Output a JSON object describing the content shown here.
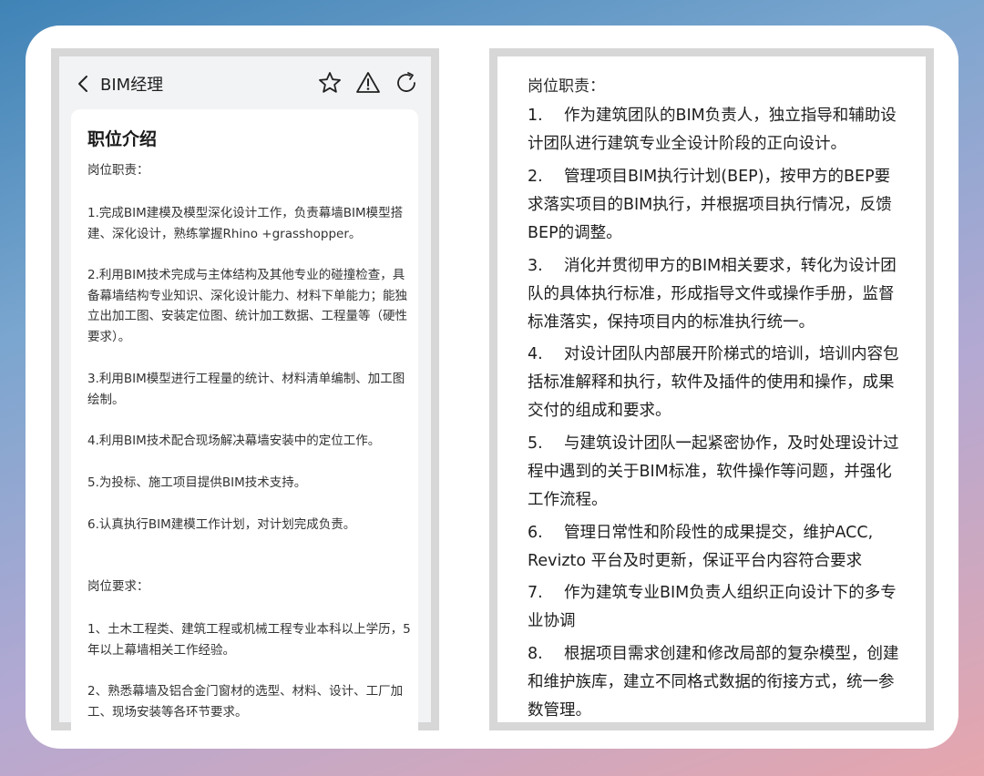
{
  "navbar": {
    "title": "BIM经理",
    "icons": [
      "back-chevron-icon",
      "star-icon",
      "warning-icon",
      "share-icon"
    ]
  },
  "job_card": {
    "section_title": "职位介绍",
    "duties_label": "岗位职责：",
    "duties": [
      "1.完成BIM建模及模型深化设计工作，负责幕墙BIM模型搭建、深化设计，熟练掌握Rhino +grasshopper。",
      "2.利用BIM技术完成与主体结构及其他专业的碰撞检查，具备幕墙结构专业知识、深化设计能力、材料下单能力；能独立出加工图、安装定位图、统计加工数据、工程量等（硬性要求）。",
      "3.利用BIM模型进行工程量的统计、材料清单编制、加工图绘制。",
      "4.利用BIM技术配合现场解决幕墙安装中的定位工作。",
      "5.为投标、施工项目提供BIM技术支持。",
      "6.认真执行BIM建模工作计划，对计划完成负责。"
    ],
    "requirements_label": "岗位要求：",
    "requirements": [
      "1、土木工程类、建筑工程或机械工程专业本科以上学历，5年以上幕墙相关工作经验。",
      "2、熟悉幕墙及铝合金门窗材的选型、材料、设计、工厂加工、现场安装等各环节要求。"
    ]
  },
  "document": {
    "heading": "岗位职责：",
    "items": [
      {
        "num": "1.",
        "text": "作为建筑团队的BIM负责人，独立指导和辅助设计团队进行建筑专业全设计阶段的正向设计。"
      },
      {
        "num": "2.",
        "text": "管理项目BIM执行计划(BEP)，按甲方的BEP要求落实项目的BIM执行，并根据项目执行情况，反馈BEP的调整。"
      },
      {
        "num": "3.",
        "text": "消化并贯彻甲方的BIM相关要求，转化为设计团队的具体执行标准，形成指导文件或操作手册，监督标准落实，保持项目内的标准执行统一。"
      },
      {
        "num": "4.",
        "text": "对设计团队内部展开阶梯式的培训，培训内容包括标准解释和执行，软件及插件的使用和操作，成果交付的组成和要求。"
      },
      {
        "num": "5.",
        "text": "与建筑设计团队一起紧密协作，及时处理设计过程中遇到的关于BIM标准，软件操作等问题，并强化工作流程。"
      },
      {
        "num": "6.",
        "text": "管理日常性和阶段性的成果提交，维护ACC, Revizto 平台及时更新，保证平台内容符合要求"
      },
      {
        "num": "7.",
        "text": "作为建筑专业BIM负责人组织正向设计下的多专业协调"
      },
      {
        "num": "8.",
        "text": "根据项目需求创建和修改局部的复杂模型，创建和维护族库，建立不同格式数据的衔接方式，统一参数管理。"
      }
    ]
  }
}
